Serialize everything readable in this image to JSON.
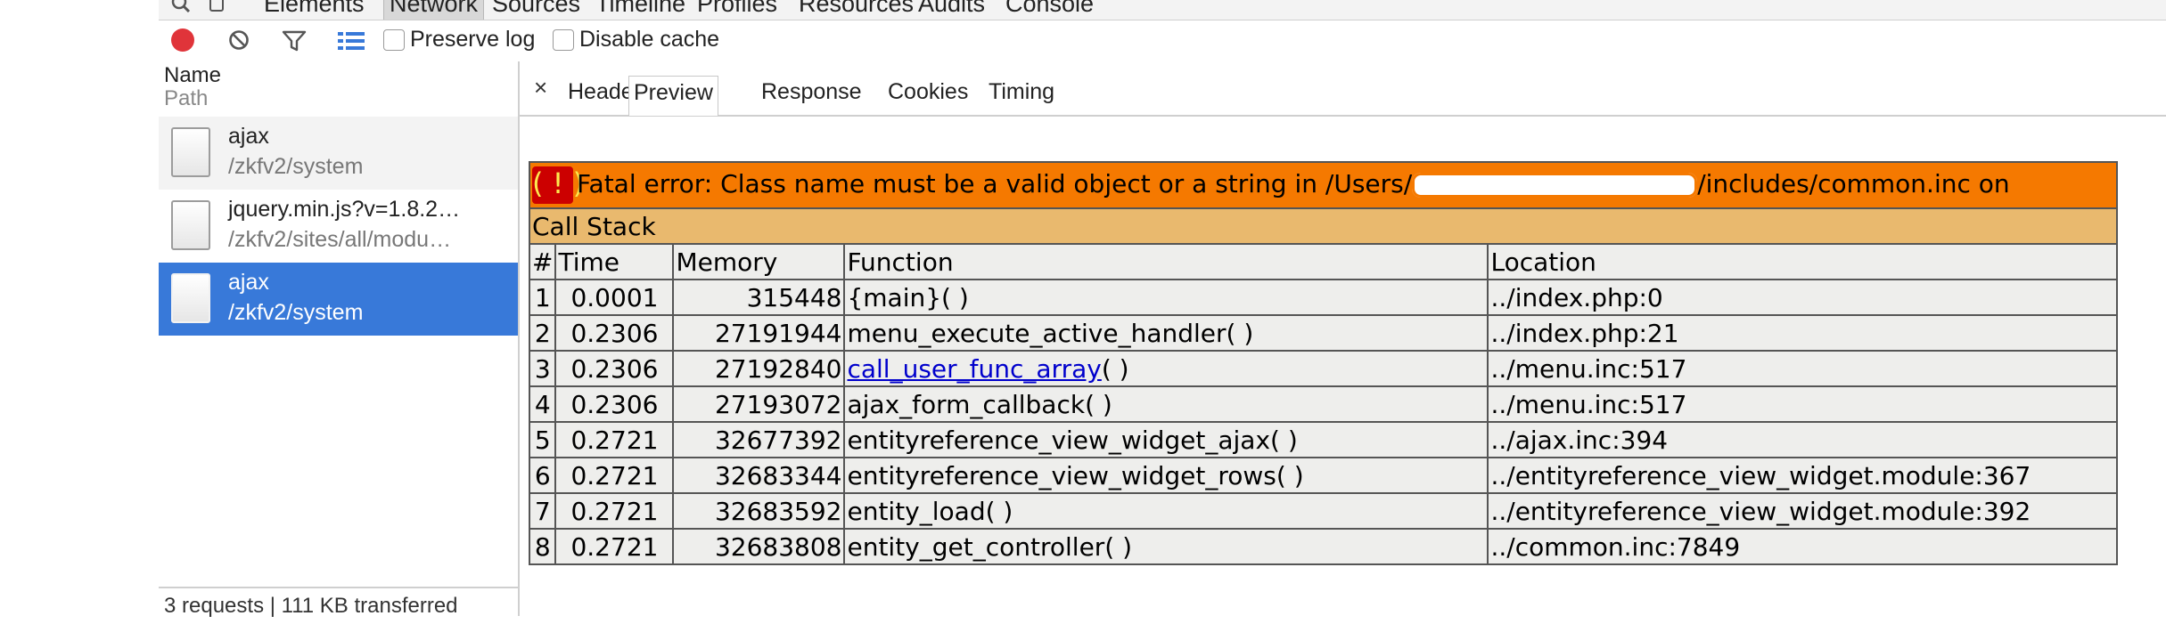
{
  "panel_tabs": [
    "Elements",
    "Network",
    "Sources",
    "Timeline",
    "Profiles",
    "Resources",
    "Audits",
    "Console"
  ],
  "active_panel": "Network",
  "toolbar": {
    "preserve_log": "Preserve log",
    "disable_cache": "Disable cache"
  },
  "list": {
    "header_name": "Name",
    "header_path": "Path",
    "items": [
      {
        "name": "ajax",
        "path": "/zkfv2/system"
      },
      {
        "name": "jquery.min.js?v=1.8.2…",
        "path": "/zkfv2/sites/all/modu…"
      },
      {
        "name": "ajax",
        "path": "/zkfv2/system"
      }
    ],
    "status": "3 requests | 111 KB transferred"
  },
  "detail_tabs": {
    "close": "×",
    "tabs": [
      "Headers",
      "Preview",
      "Response",
      "Cookies",
      "Timing"
    ],
    "active": "Preview"
  },
  "error": {
    "icon": "( ! )",
    "message_start": "Fatal error: Class name must be a valid object or a string in /Users/",
    "message_end": "/includes/common.inc on",
    "call_stack_label": "Call Stack",
    "columns": [
      "#",
      "Time",
      "Memory",
      "Function",
      "Location"
    ],
    "rows": [
      {
        "n": "1",
        "time": "0.0001",
        "memory": "315448",
        "func": "{main}( )",
        "link": "",
        "func_tail": "",
        "loc": "../index.php:0"
      },
      {
        "n": "2",
        "time": "0.2306",
        "memory": "27191944",
        "func": "menu_execute_active_handler( )",
        "link": "",
        "func_tail": "",
        "loc": "../index.php:21"
      },
      {
        "n": "3",
        "time": "0.2306",
        "memory": "27192840",
        "func": "",
        "link": "call_user_func_array",
        "func_tail": "( )",
        "loc": "../menu.inc:517"
      },
      {
        "n": "4",
        "time": "0.2306",
        "memory": "27193072",
        "func": "ajax_form_callback( )",
        "link": "",
        "func_tail": "",
        "loc": "../menu.inc:517"
      },
      {
        "n": "5",
        "time": "0.2721",
        "memory": "32677392",
        "func": "entityreference_view_widget_ajax( )",
        "link": "",
        "func_tail": "",
        "loc": "../ajax.inc:394"
      },
      {
        "n": "6",
        "time": "0.2721",
        "memory": "32683344",
        "func": "entityreference_view_widget_rows( )",
        "link": "",
        "func_tail": "",
        "loc": "../entityreference_view_widget.module:367"
      },
      {
        "n": "7",
        "time": "0.2721",
        "memory": "32683592",
        "func": "entity_load( )",
        "link": "",
        "func_tail": "",
        "loc": "../entityreference_view_widget.module:392"
      },
      {
        "n": "8",
        "time": "0.2721",
        "memory": "32683808",
        "func": "entity_get_controller( )",
        "link": "",
        "func_tail": "",
        "loc": "../common.inc:7849"
      }
    ]
  },
  "colors": {
    "record": "#e0343a",
    "selected": "#3879d9",
    "error_bg": "#f57900",
    "callstack_bg": "#e9b96e"
  }
}
